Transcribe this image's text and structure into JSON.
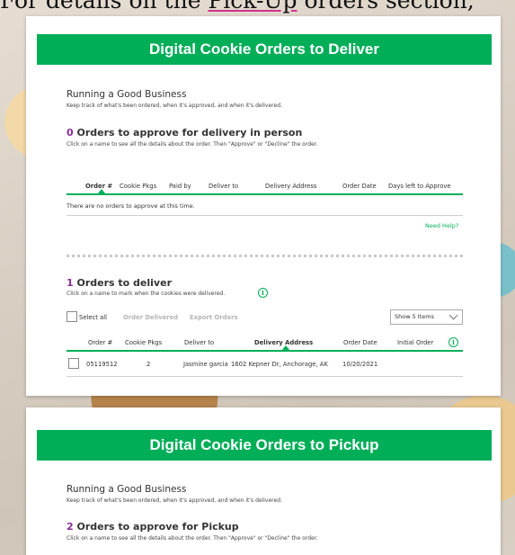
{
  "banner": {
    "text_before": "For details on the ",
    "text_underlined": "Pick-Up",
    "text_after": " orders section,"
  },
  "deliver_card": {
    "header": "Digital Cookie Orders to Deliver",
    "intro_title": "Running a Good Business",
    "intro_sub": "Keep track of what's been ordered, when it's approved, and when it's delivered.",
    "approve_section": {
      "count": "0",
      "title": "Orders to approve for delivery in person",
      "subtitle": "Click on a name to see all the details about the order. Then \"Approve\" or \"Decline\" the order.",
      "columns": [
        "Order #",
        "Cookie Pkgs",
        "Paid by",
        "Deliver to",
        "Delivery Address",
        "Order Date",
        "Days left to Approve"
      ],
      "empty_text": "There are no orders to approve at this time.",
      "help_link": "Need Help?"
    },
    "deliver_section": {
      "count": "1",
      "title": "Orders to deliver",
      "subtitle": "Click on a name to mark when the cookies were delivered.",
      "select_all": "Select all",
      "order_delivered": "Order Delivered",
      "export_orders": "Export Orders",
      "show_items": "Show 5 Items",
      "columns": [
        "Order #",
        "Cookie Pkgs",
        "Deliver to",
        "Delivery Address",
        "Order Date",
        "Initial Order"
      ],
      "rows": [
        {
          "order_no": "05119512",
          "pkgs": "2",
          "deliver_to": "Jasmine garcia",
          "address": "1602 Kepner Dr, Anchorage, AK",
          "date": "10/20/2021"
        }
      ]
    }
  },
  "pickup_card": {
    "header": "Digital Cookie Orders to Pickup",
    "intro_title": "Running a Good Business",
    "intro_sub": "Keep track of what's been ordered, when it's approved, and when it's delivered.",
    "approve_section": {
      "count": "2",
      "title": "Orders to approve for Pickup",
      "subtitle": "Click on a name to see all the details about the order. Then \"Approve\" or \"Decline\" the order."
    }
  },
  "icons": {
    "info": "info-circle-icon",
    "chevron": "chevron-down-icon"
  },
  "colors": {
    "brand_green": "#00ae58",
    "count_purple": "#8a2b9c"
  }
}
